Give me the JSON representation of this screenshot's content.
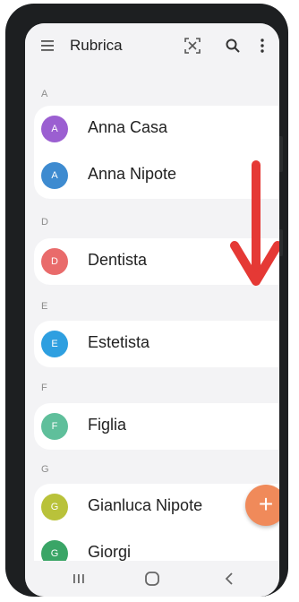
{
  "app": {
    "title": "Rubrica"
  },
  "contacts": {
    "sections": [
      {
        "letter": "A",
        "items": [
          {
            "initial": "A",
            "name": "Anna Casa",
            "avatar_color": "#9b5fd1"
          },
          {
            "initial": "A",
            "name": "Anna Nipote",
            "avatar_color": "#3e8bd0"
          }
        ]
      },
      {
        "letter": "D",
        "items": [
          {
            "initial": "D",
            "name": "Dentista",
            "avatar_color": "#e96b6b"
          }
        ]
      },
      {
        "letter": "E",
        "items": [
          {
            "initial": "E",
            "name": "Estetista",
            "avatar_color": "#2e9fe0"
          }
        ]
      },
      {
        "letter": "F",
        "items": [
          {
            "initial": "F",
            "name": "Figlia",
            "avatar_color": "#5fbf9b"
          }
        ]
      },
      {
        "letter": "G",
        "items": [
          {
            "initial": "G",
            "name": "Gianluca Nipote",
            "avatar_color": "#b9c23a"
          },
          {
            "initial": "G",
            "name": "Giorgi",
            "avatar_color": "#3aa566"
          }
        ]
      }
    ]
  },
  "fab": {
    "label": "+",
    "color": "#f08a5a"
  },
  "overlay": {
    "arrow_color": "#e53935"
  },
  "icons": {
    "menu": "hamburger-menu-icon",
    "scan": "scan-icon",
    "search": "search-icon",
    "more": "more-vertical-icon",
    "nav_recents": "recents-icon",
    "nav_home": "home-icon",
    "nav_back": "back-icon"
  }
}
